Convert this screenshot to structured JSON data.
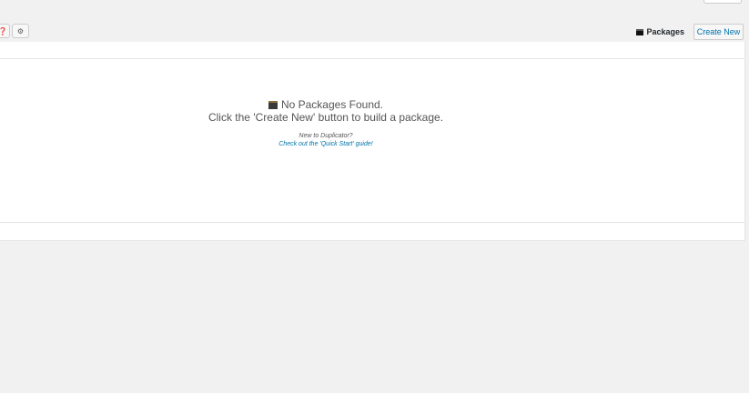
{
  "toolbar": {
    "help_icon": "question-circle-icon",
    "settings_icon": "gear-icon",
    "packages_label": "Packages",
    "packages_icon": "archive-icon",
    "create_new_label": "Create New"
  },
  "empty_state": {
    "icon": "archive-icon",
    "title": "No Packages Found.",
    "subtitle": "Click the 'Create New' button to build a package.",
    "new_to": "New to Duplicator?",
    "guide_link": "Check out the 'Quick Start' guide!"
  },
  "colors": {
    "background": "#f1f1f1",
    "panel": "#ffffff",
    "link": "#0073aa"
  }
}
